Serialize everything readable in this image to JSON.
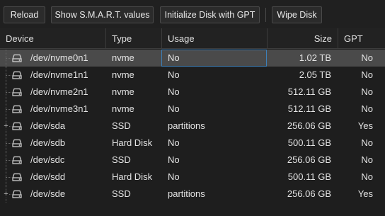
{
  "toolbar": {
    "buttons": [
      {
        "label": "Reload"
      },
      {
        "label": "Show S.M.A.R.T. values"
      },
      {
        "label": "Initialize Disk with GPT"
      },
      {
        "label": "Wipe Disk"
      }
    ]
  },
  "table": {
    "columns": [
      {
        "label": "Device"
      },
      {
        "label": "Type"
      },
      {
        "label": "Usage"
      },
      {
        "label": "Size"
      },
      {
        "label": "GPT"
      }
    ],
    "rows": [
      {
        "device": "/dev/nvme0n1",
        "type": "nvme",
        "usage": "No",
        "size": "1.02 TB",
        "gpt": "No",
        "expandable": false,
        "selected": true
      },
      {
        "device": "/dev/nvme1n1",
        "type": "nvme",
        "usage": "No",
        "size": "2.05 TB",
        "gpt": "No",
        "expandable": false,
        "selected": false
      },
      {
        "device": "/dev/nvme2n1",
        "type": "nvme",
        "usage": "No",
        "size": "512.11 GB",
        "gpt": "No",
        "expandable": false,
        "selected": false
      },
      {
        "device": "/dev/nvme3n1",
        "type": "nvme",
        "usage": "No",
        "size": "512.11 GB",
        "gpt": "No",
        "expandable": false,
        "selected": false
      },
      {
        "device": "/dev/sda",
        "type": "SSD",
        "usage": "partitions",
        "size": "256.06 GB",
        "gpt": "Yes",
        "expandable": true,
        "selected": false
      },
      {
        "device": "/dev/sdb",
        "type": "Hard Disk",
        "usage": "No",
        "size": "500.11 GB",
        "gpt": "No",
        "expandable": false,
        "selected": false
      },
      {
        "device": "/dev/sdc",
        "type": "SSD",
        "usage": "No",
        "size": "256.06 GB",
        "gpt": "No",
        "expandable": false,
        "selected": false
      },
      {
        "device": "/dev/sdd",
        "type": "Hard Disk",
        "usage": "No",
        "size": "500.11 GB",
        "gpt": "No",
        "expandable": false,
        "selected": false
      },
      {
        "device": "/dev/sde",
        "type": "SSD",
        "usage": "partitions",
        "size": "256.06 GB",
        "gpt": "Yes",
        "expandable": true,
        "selected": false
      }
    ]
  },
  "icons": {
    "row_icon": "hard-drive-icon",
    "expander": "expand-plus-icon"
  },
  "colors": {
    "background": "#1e1e1e",
    "selected_row": "#4a4a4a",
    "focus_border": "#3d7fb8"
  }
}
